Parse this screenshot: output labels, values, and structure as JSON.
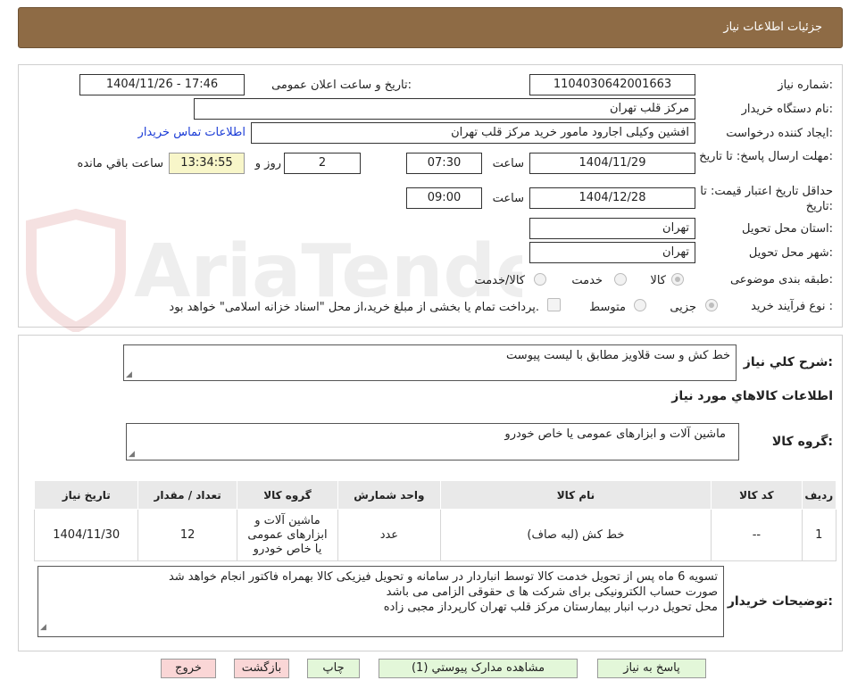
{
  "header": {
    "title": "جزئیات اطلاعات نیاز"
  },
  "form": {
    "need_number_label": "شماره نیاز:",
    "need_number": "1104030642001663",
    "announce_label": "تاریخ و ساعت اعلان عمومی:",
    "announce_value": "1404/11/26 - 17:46",
    "buyer_org_label": "نام دستگاه خریدار:",
    "buyer_org": "مرکز قلب تهران",
    "creator_label": "ایجاد کننده درخواست:",
    "creator": "افشین وکیلی اجارود مامور خرید مرکز قلب تهران",
    "contact_link": "اطلاعات تماس خریدار",
    "send_deadline_label": "مهلت ارسال پاسخ: تا تاریخ:",
    "send_date": "1404/11/29",
    "time_label": "ساعت",
    "send_time": "07:30",
    "days": "2",
    "days_label": "روز و",
    "remaining_time": "13:34:55",
    "remaining_label": "ساعت باقي مانده",
    "validity_label": "حداقل تاریخ اعتبار قیمت: تا تاریخ:",
    "validity_date": "1404/12/28",
    "validity_time": "09:00",
    "province_label": "استان محل تحویل:",
    "province": "تهران",
    "city_label": "شهر محل تحویل:",
    "city": "تهران",
    "category_label": "طبقه بندی موضوعی:",
    "category_options": [
      "کالا",
      "خدمت",
      "کالا/خدمت"
    ],
    "process_label": "نوع فرآیند خرید :",
    "process_options": [
      "جزیی",
      "متوسط"
    ],
    "process_note": "پرداخت تمام یا بخشی از مبلغ خرید،از محل \"اسناد خزانه اسلامی\" خواهد بود."
  },
  "description": {
    "label": "شرح كلي نياز:",
    "value": "خط کش و ست قلاویز مطابق با لیست پیوست"
  },
  "goods": {
    "section_title": "اطلاعات كالاهاي مورد نياز",
    "group_label": "گروه کالا:",
    "group_value": "ماشین آلات و ابزارهای عمومی یا خاص خودرو",
    "columns": [
      "رديف",
      "کد کالا",
      "نام کالا",
      "واحد شمارش",
      "گروه کالا",
      "تعداد / مقدار",
      "تاريخ نياز"
    ],
    "rows": [
      {
        "row": "1",
        "code": "--",
        "name": "خط کش (لبه صاف)",
        "unit": "عدد",
        "group": "ماشین آلات و ابزارهای عمومی یا خاص خودرو",
        "qty": "12",
        "date": "1404/11/30"
      }
    ]
  },
  "buyer_notes": {
    "label": "توضیحات خریدار:",
    "lines": [
      "تسویه 6 ماه پس از تحویل خدمت کالا توسط انباردار در سامانه و تحویل فیزیکی کالا بهمراه فاکتور انجام خواهد شد",
      "صورت حساب الکترونیکی برای شرکت ها ی حقوقی الزامی می باشد",
      "محل تحویل درب انبار بیمارستان مرکز قلب تهران کارپرداز مجبی زاده"
    ]
  },
  "buttons": {
    "reply": "پاسخ به نیاز",
    "attachments": "مشاهده مدارک پیوستي (1)",
    "print": "چاپ",
    "back": "بازگشت",
    "exit": "خروج"
  },
  "watermark": {
    "text": "AriaTender.neT"
  }
}
